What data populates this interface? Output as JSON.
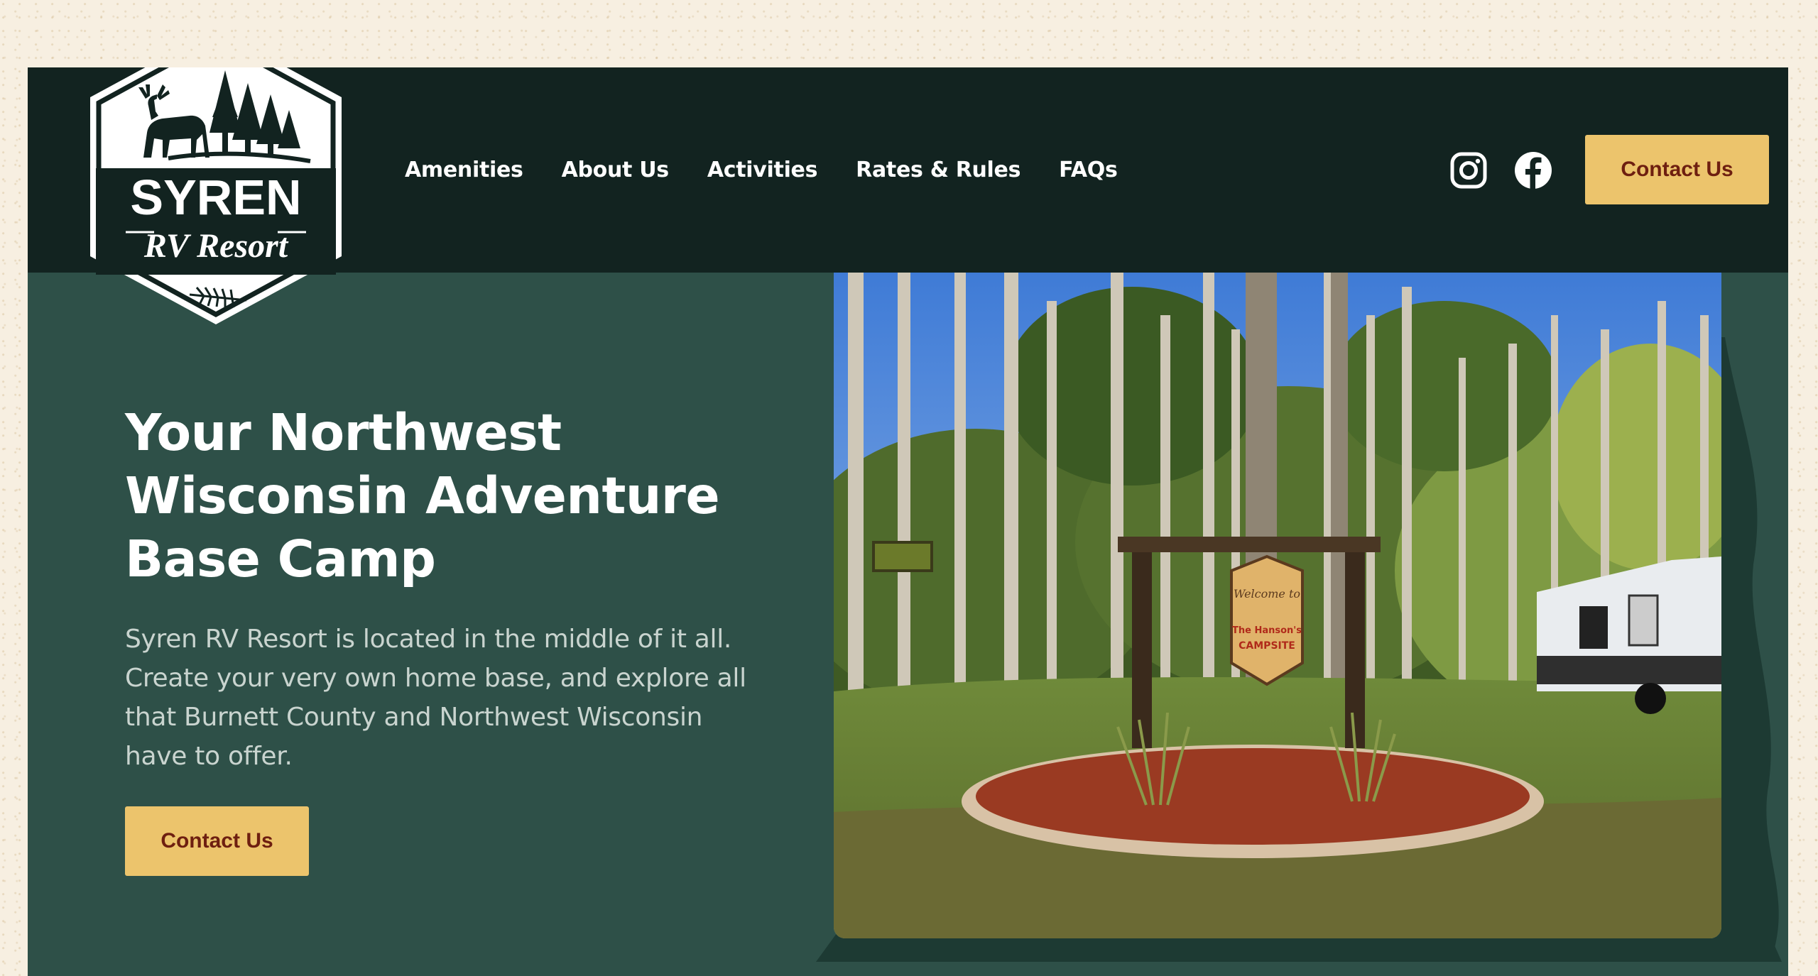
{
  "brand": {
    "logo_line1": "SYREN",
    "logo_line2": "RV Resort"
  },
  "nav": {
    "items": [
      {
        "label": "Amenities"
      },
      {
        "label": "About Us"
      },
      {
        "label": "Activities"
      },
      {
        "label": "Rates & Rules"
      },
      {
        "label": "FAQs"
      }
    ]
  },
  "social": {
    "instagram": "instagram-icon",
    "facebook": "facebook-icon"
  },
  "header": {
    "contact_label": "Contact Us"
  },
  "hero": {
    "title_line1": "Your Northwest",
    "title_line2": "Wisconsin Adventure",
    "title_line3": "Base Camp",
    "text_line1": "Syren RV Resort is located in the middle of it all.",
    "text_line2": "Create your very own home base, and explore all",
    "text_line3": "that Burnett County and Northwest Wisconsin",
    "text_line4": "have to offer.",
    "cta_label": "Contact Us"
  },
  "photo": {
    "sign_line1": "Welcome to",
    "sign_line2": "The Hanson's",
    "sign_line3": "CAMPSITE"
  },
  "colors": {
    "page_bg": "#f7efe1",
    "header_bg": "#122320",
    "hero_bg": "#2e5048",
    "accent": "#ecc46c",
    "accent_text": "#6e1f10"
  }
}
